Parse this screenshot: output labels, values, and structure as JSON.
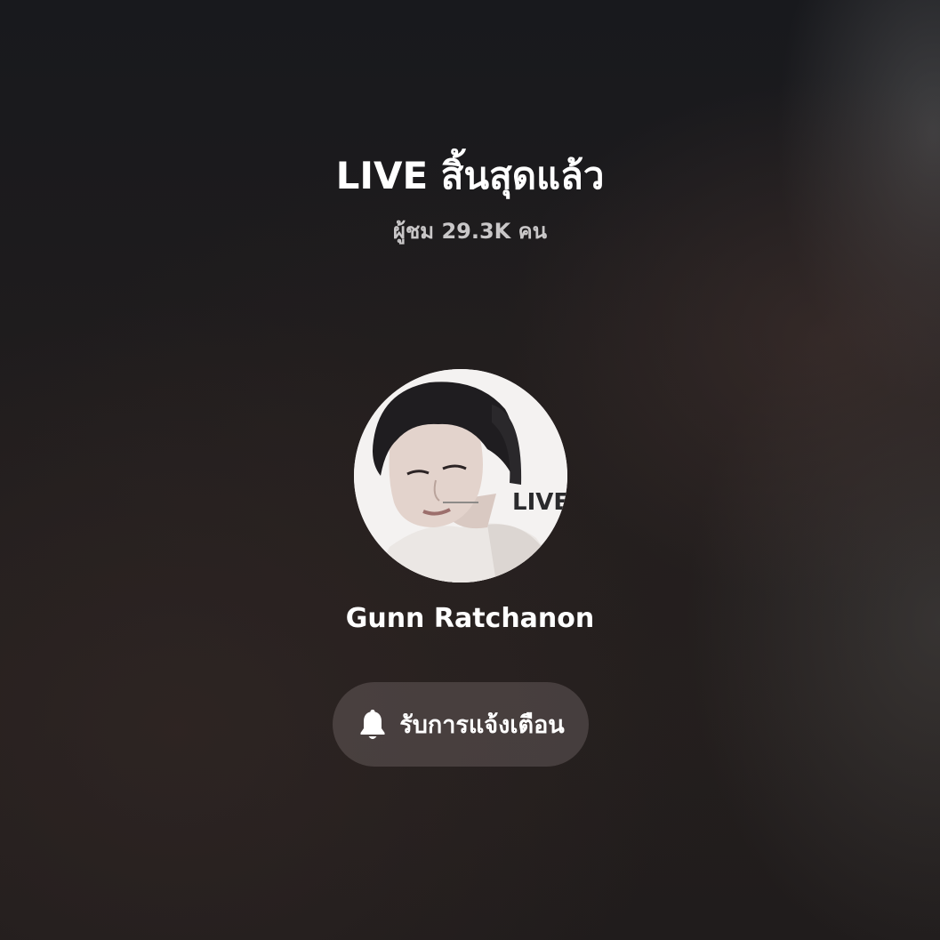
{
  "status": {
    "title": "LIVE สิ้นสุดแล้ว",
    "viewers_text": "ผู้ชม 29.3K คน"
  },
  "host": {
    "name": "Gunn Ratchanon",
    "avatar_overlay_text": "LIVE"
  },
  "notify_button": {
    "icon": "bell-icon",
    "label": "รับการแจ้งเตือน"
  },
  "colors": {
    "title_text": "#ffffff",
    "subtitle_text": "#c9c7c8",
    "button_bg": "rgba(110,100,100,0.45)"
  }
}
